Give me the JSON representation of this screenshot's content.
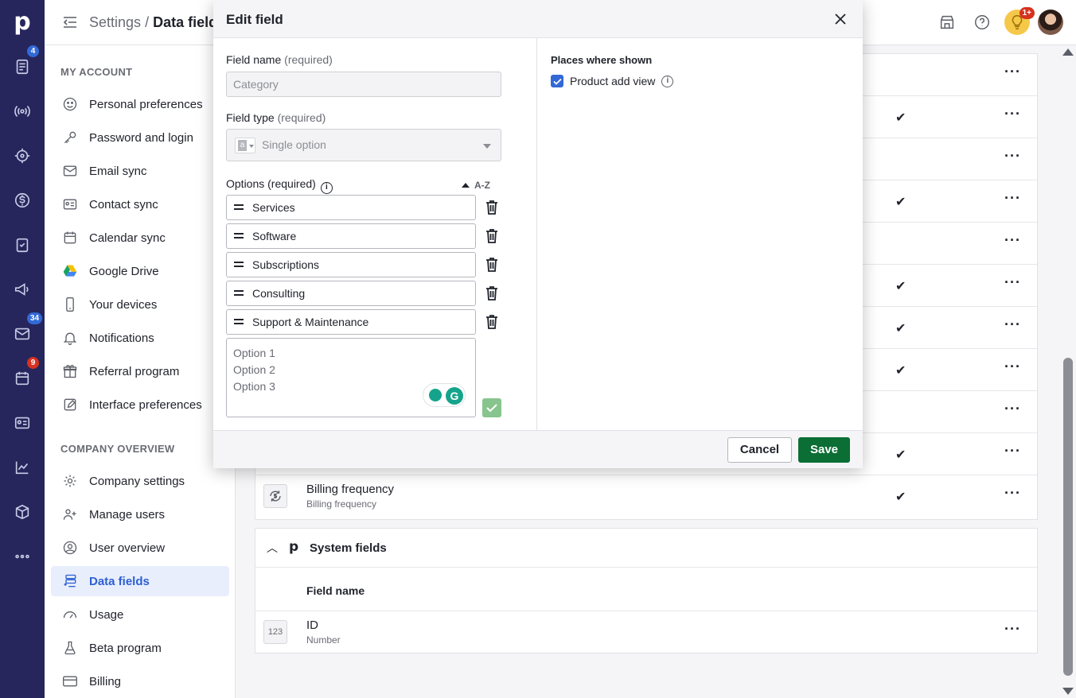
{
  "rail": {
    "badges": {
      "leads": "4",
      "mail": "34",
      "activities": "9"
    }
  },
  "header": {
    "breadcrumb_parent": "Settings",
    "breadcrumb_sep": "/",
    "breadcrumb_current": "Data fields",
    "bulb_badge": "1+"
  },
  "sidebar": {
    "my_account_title": "MY ACCOUNT",
    "my_account_items": [
      "Personal preferences",
      "Password and login",
      "Email sync",
      "Contact sync",
      "Calendar sync",
      "Google Drive",
      "Your devices",
      "Notifications",
      "Referral program",
      "Interface preferences"
    ],
    "company_title": "COMPANY OVERVIEW",
    "company_items": [
      "Company settings",
      "Manage users",
      "User overview",
      "Data fields",
      "Usage",
      "Beta program",
      "Billing"
    ]
  },
  "main": {
    "billing_row": {
      "name": "Billing frequency",
      "sub": "Billing frequency"
    },
    "system_fields_title": "System fields",
    "column_field_name": "Field name",
    "id_row": {
      "icon_text": "123",
      "name": "ID",
      "sub": "Number"
    }
  },
  "dialog": {
    "title": "Edit field",
    "field_name_label": "Field name",
    "required_label": "(required)",
    "field_name_value": "Category",
    "field_type_label": "Field type",
    "field_type_value": "Single option",
    "options_label": "Options (required)",
    "sort_label": "A-Z",
    "options": [
      "Services",
      "Software",
      "Subscriptions",
      "Consulting",
      "Support & Maintenance"
    ],
    "new_options_placeholder": "Option 1\nOption 2\nOption 3",
    "places_title": "Places where shown",
    "places_item": "Product add view",
    "cancel_label": "Cancel",
    "save_label": "Save",
    "grammarly_letter": "G"
  },
  "colors": {
    "rail_bg": "#26265c",
    "accent_blue": "#3269d6",
    "save_green": "#0b6e34",
    "badge_red": "#d5321f"
  }
}
